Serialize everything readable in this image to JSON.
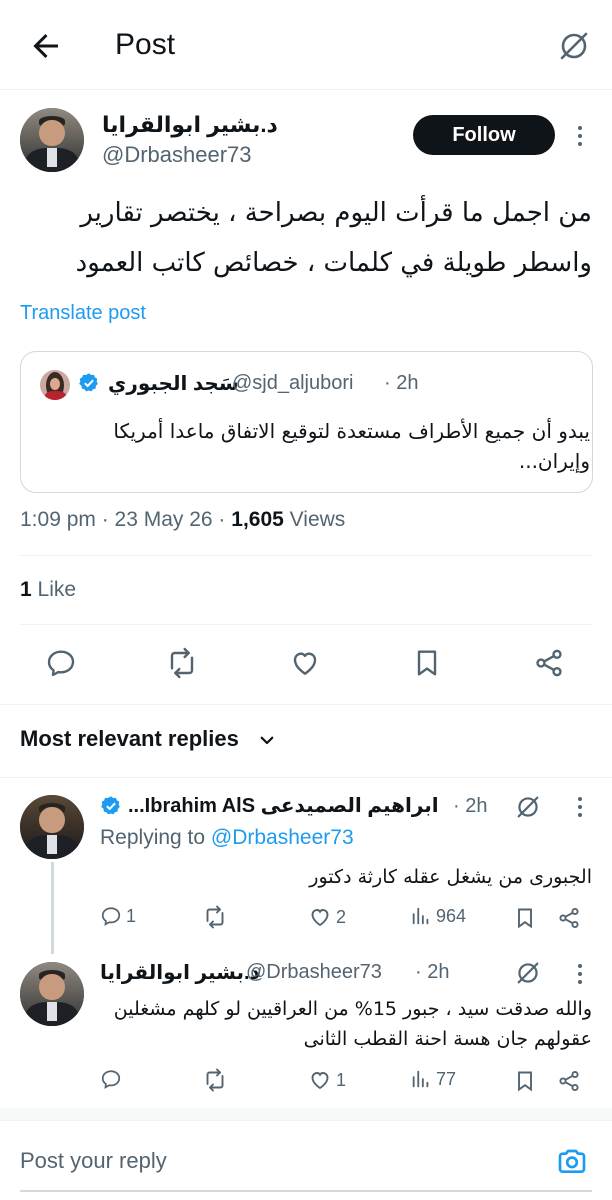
{
  "header": {
    "title": "Post",
    "back_icon": "arrow-left-icon",
    "grok_icon": "grok-icon"
  },
  "post": {
    "author_name": "د.بشير ابوالقرايا",
    "author_handle": "@Drbasheer73",
    "follow_label": "Follow",
    "text": "من اجمل ما قرأت اليوم بصراحة ، يختصر تقارير واسطر طويلة في كلمات ، خصائص كاتب العمود",
    "translate_label": "Translate post",
    "quote": {
      "author_name": "سَجد الجبوري",
      "author_handle": "@sjd_aljubori",
      "time": "· 2h",
      "text": "يبدو أن جميع الأطراف مستعدة لتوقيع الاتفاق ماعدا أمريكا وإيران..."
    },
    "timestamp": "1:09 pm · 23 May 26 · ",
    "views_count": "1,605",
    "views_label": " Views",
    "like_count": "1",
    "like_label": " Like"
  },
  "actions": [
    "reply-icon",
    "repost-icon",
    "like-icon",
    "bookmark-icon",
    "share-icon"
  ],
  "replies_header": "Most relevant replies",
  "replies": [
    {
      "author_name": "ابراهيم الصميدعى Ibrahim AlS...",
      "time": "· 2h",
      "replying_prefix": "Replying to ",
      "replying_handle": "@Drbasheer73",
      "text": "الجبورى من يشغل عقله كارثة دكتور",
      "reply_count": "1",
      "repost_count": "",
      "like_count": "2",
      "views": "964"
    },
    {
      "author_name": "د.بشير ابوالقرايا",
      "author_handle": "@Drbasheer73",
      "time": "· 2h",
      "text": "والله صدقت سيد ، جبور 15% من العراقيين لو كلهم مشغلين عقولهم جان هسة احنة القطب الثانى",
      "reply_count": "",
      "repost_count": "",
      "like_count": "1",
      "views": "77"
    }
  ],
  "composer": {
    "placeholder": "Post your reply",
    "camera_icon": "camera-icon"
  },
  "colors": {
    "accent": "#1d9bf0",
    "text": "#0f1419",
    "muted": "#536471",
    "verified": "#1d9bf0"
  }
}
